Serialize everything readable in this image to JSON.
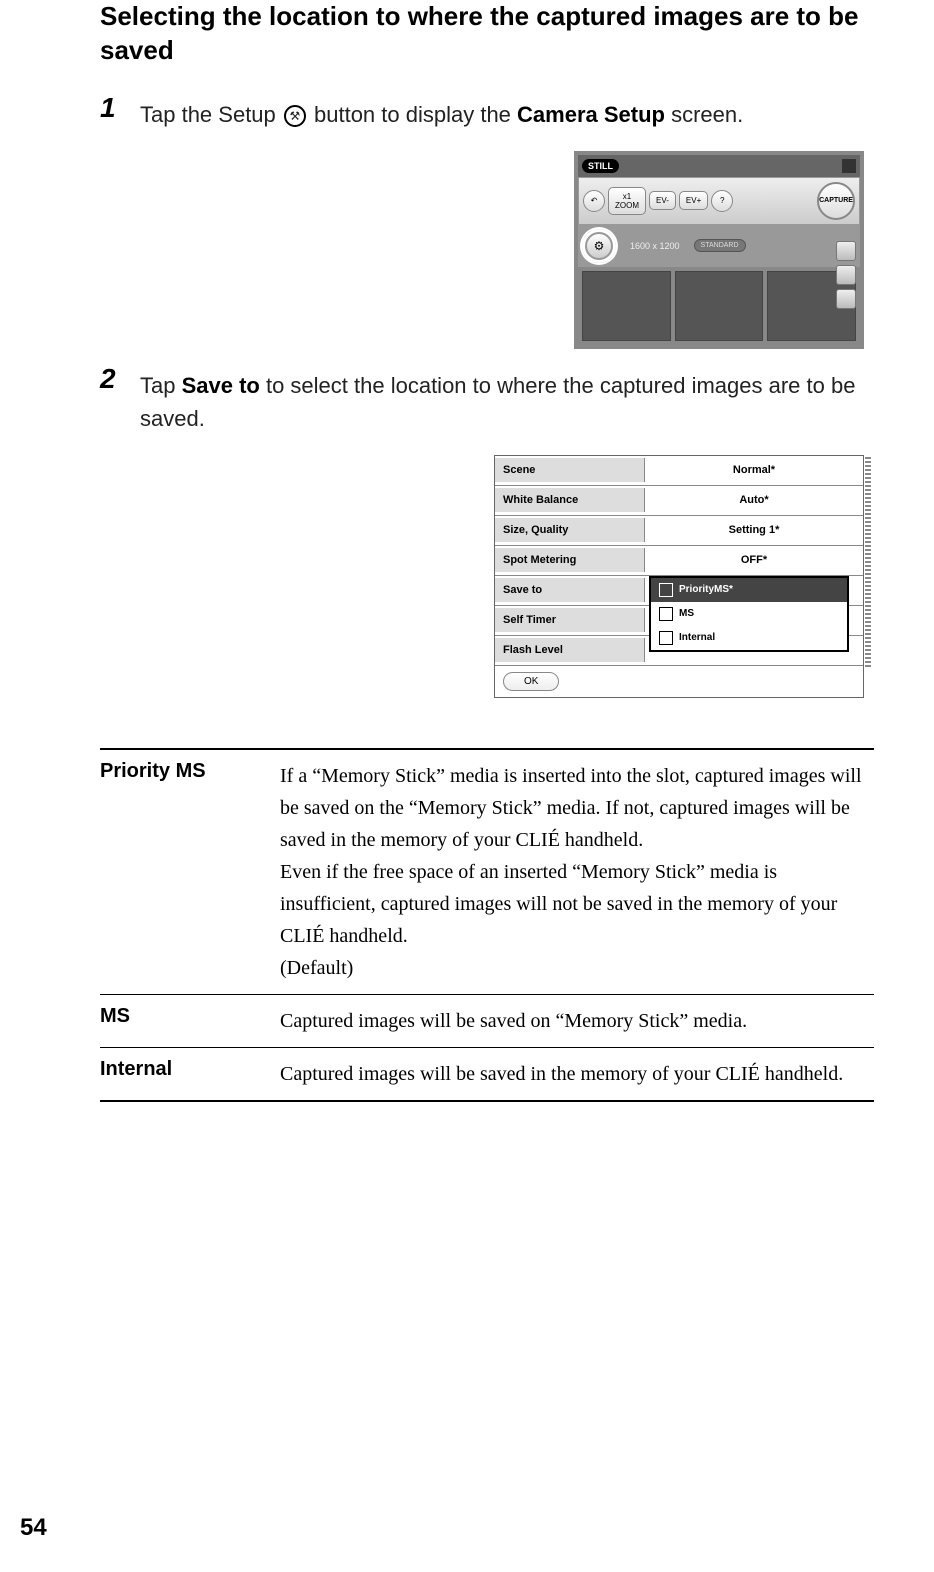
{
  "title": "Selecting the location to where the captured images are to be saved",
  "steps": {
    "s1": {
      "num": "1",
      "pre": "Tap the Setup ",
      "post": " button to display the ",
      "bold": "Camera Setup",
      "tail": " screen."
    },
    "s2": {
      "num": "2",
      "pre": "Tap ",
      "bold": "Save to",
      "post": " to select the location to where the captured images are to be saved."
    }
  },
  "cam": {
    "still": "STILL",
    "zoom_x1": "x1",
    "zoom": "ZOOM",
    "ev_minus": "EV-",
    "ev_plus": "EV+",
    "capture": "CAPTURE",
    "resolution": "1600 x 1200",
    "standard": "STANDARD"
  },
  "setup": {
    "rows": [
      {
        "label": "Scene",
        "value": "Normal*"
      },
      {
        "label": "White Balance",
        "value": "Auto*"
      },
      {
        "label": "Size, Quality",
        "value": "Setting 1*"
      },
      {
        "label": "Spot Metering",
        "value": "OFF*"
      },
      {
        "label": "Save to",
        "value": ""
      },
      {
        "label": "Self Timer",
        "value": ""
      },
      {
        "label": "Flash Level",
        "value": ""
      }
    ],
    "popup": [
      "PriorityMS*",
      "MS",
      "Internal"
    ],
    "ok": "OK"
  },
  "defs": [
    {
      "term": "Priority MS",
      "desc": "If a “Memory Stick” media is inserted into the slot, captured images will be saved on the “Memory Stick” media. If not, captured images will be saved in the memory of your CLIÉ handheld.\nEven if the free space of an inserted “Memory Stick” media is insufficient, captured images will not be saved in the memory of your CLIÉ handheld.\n(Default)"
    },
    {
      "term": "MS",
      "desc": "Captured images will be saved on “Memory Stick” media."
    },
    {
      "term": "Internal",
      "desc": "Captured images will be saved in the memory of your CLIÉ handheld."
    }
  ],
  "page_num": "54"
}
